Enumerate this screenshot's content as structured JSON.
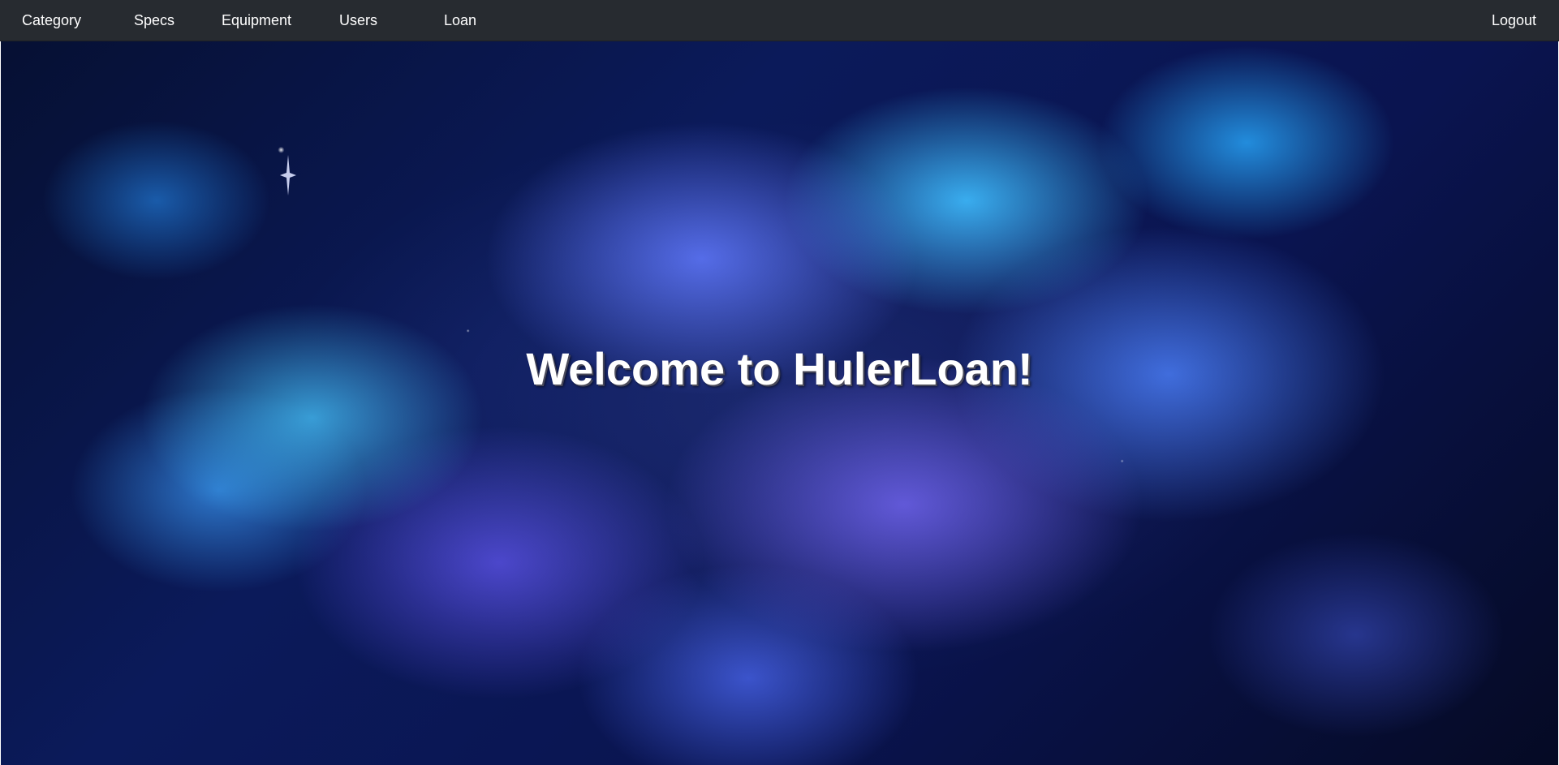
{
  "navbar": {
    "items": [
      {
        "label": "Category"
      },
      {
        "label": "Specs"
      },
      {
        "label": "Equipment"
      },
      {
        "label": "Users"
      },
      {
        "label": "Loan"
      }
    ],
    "logout_label": "Logout",
    "background_color": "#272b30"
  },
  "hero": {
    "title": "Welcome to HulerLoan!",
    "background_image": "abstract-blue-purple-smoke-nebula"
  }
}
